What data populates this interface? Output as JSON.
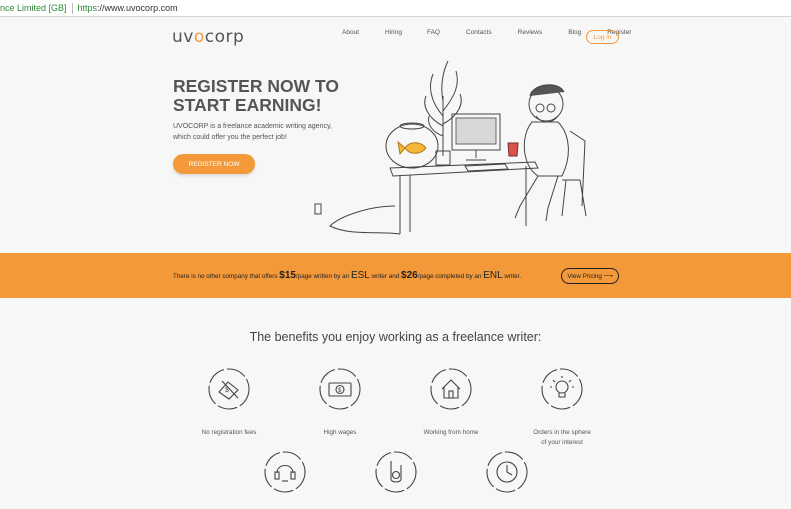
{
  "browser": {
    "cert_label": "nce Limited [GB]",
    "url_scheme": "https",
    "url_rest": "://www.uvocorp.com"
  },
  "header": {
    "logo_text_1": "uv",
    "logo_o": "o",
    "logo_text_2": "corp",
    "nav": [
      "About",
      "Hiring",
      "FAQ",
      "Contacts",
      "Reviews",
      "Blog",
      "Register"
    ],
    "login": "Log in"
  },
  "hero": {
    "title_line1": "REGISTER NOW TO",
    "title_line2": "START EARNING!",
    "subtitle_line1": "UVOCORP is a freelance academic writing agency,",
    "subtitle_line2": "which could offer you the perfect job!",
    "cta": "REGISTER NOW"
  },
  "band": {
    "t1": "There is no other company that offers ",
    "price1": "$15",
    "t2": "/page written by an ",
    "esl": "ESL",
    "t3": " writer and ",
    "price2": "$26",
    "t4": "/page completed by an ",
    "enl": "ENL",
    "t5": " writer.",
    "button": "View Pricing ⟶"
  },
  "benefits": {
    "title": "The benefits you enjoy working as a freelance writer:",
    "items": [
      {
        "label": "No registration fees",
        "icon": "no-fees-icon"
      },
      {
        "label": "High wages",
        "icon": "money-icon"
      },
      {
        "label": "Working from home",
        "icon": "home-icon"
      },
      {
        "label_line1": "Orders in the sphere",
        "label_line2": "of your interest",
        "icon": "lightbulb-icon"
      }
    ]
  },
  "colors": {
    "accent": "#f3993a",
    "text": "#555555"
  }
}
